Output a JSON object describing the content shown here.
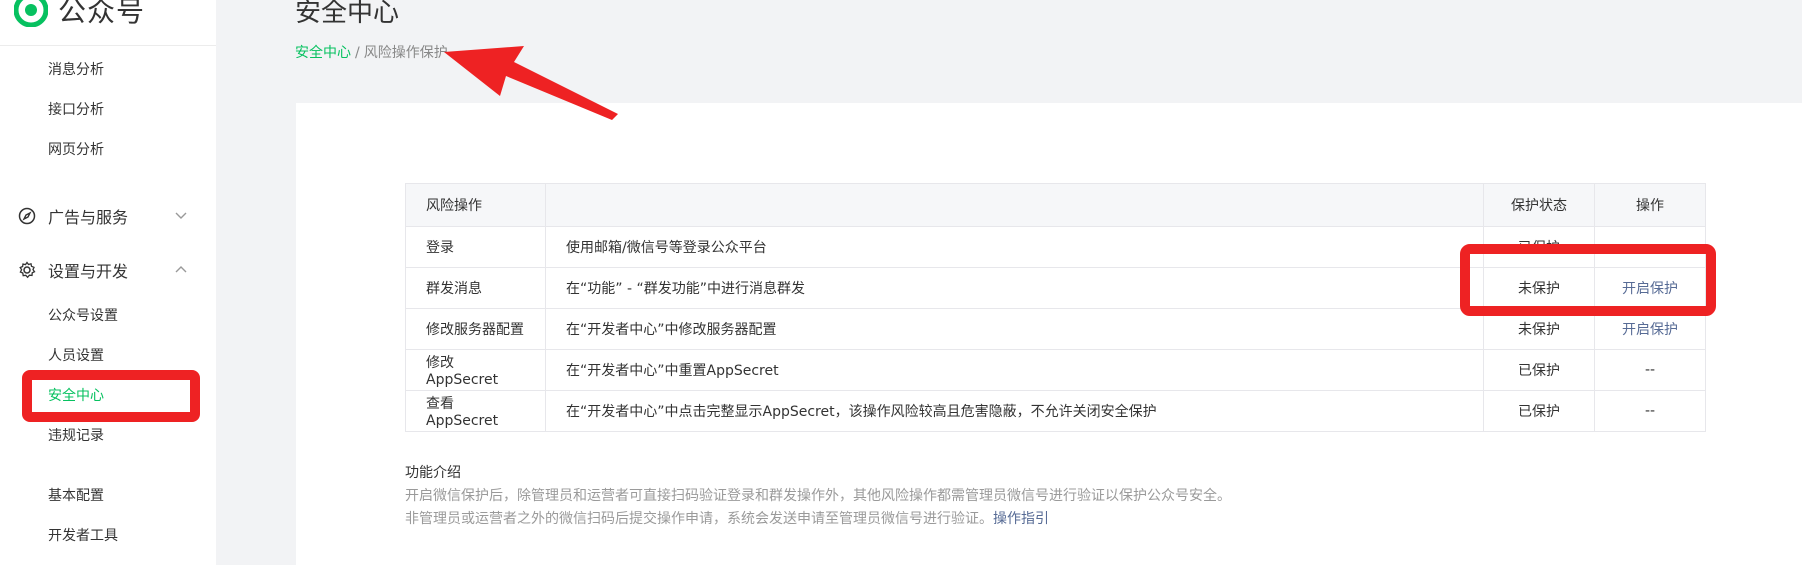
{
  "sidebar": {
    "logo_text": "公众号",
    "analysis_items": [
      "消息分析",
      "接口分析",
      "网页分析"
    ],
    "group_ads": "广告与服务",
    "group_settings": "设置与开发",
    "settings_items": [
      "公众号设置",
      "人员设置",
      "安全中心",
      "违规记录"
    ],
    "dev_items": [
      "基本配置",
      "开发者工具"
    ]
  },
  "header": {
    "title": "安全中心",
    "breadcrumb_root": "安全中心",
    "breadcrumb_sep": "/",
    "breadcrumb_current": "风险操作保护"
  },
  "table": {
    "headers": [
      "风险操作",
      "",
      "保护状态",
      "操作"
    ],
    "rows": [
      {
        "op": "登录",
        "desc": "使用邮箱/微信号等登录公众平台",
        "status": "已保护",
        "action": "--"
      },
      {
        "op": "群发消息",
        "desc": "在“功能” - “群发功能”中进行消息群发",
        "status": "未保护",
        "action": "开启保护"
      },
      {
        "op": "修改服务器配置",
        "desc": "在“开发者中心”中修改服务器配置",
        "status": "未保护",
        "action": "开启保护"
      },
      {
        "op": "修改AppSecret",
        "desc": "在“开发者中心”中重置AppSecret",
        "status": "已保护",
        "action": "--"
      },
      {
        "op": "查看AppSecret",
        "desc": "在“开发者中心”中点击完整显示AppSecret，该操作风险较高且危害隐蔽，不允许关闭安全保护",
        "status": "已保护",
        "action": "--"
      }
    ]
  },
  "intro": {
    "title": "功能介绍",
    "line1": "开启微信保护后，除管理员和运营者可直接扫码验证登录和群发操作外，其他风险操作都需管理员微信号进行验证以保护公众号安全。",
    "line2": "非管理员或运营者之外的微信扫码后提交操作申请，系统会发送申请至管理员微信号进行验证。",
    "line2_link": "操作指引"
  },
  "colors": {
    "brand": "#07c160",
    "link": "#576b95",
    "annotation": "#ee2223"
  }
}
